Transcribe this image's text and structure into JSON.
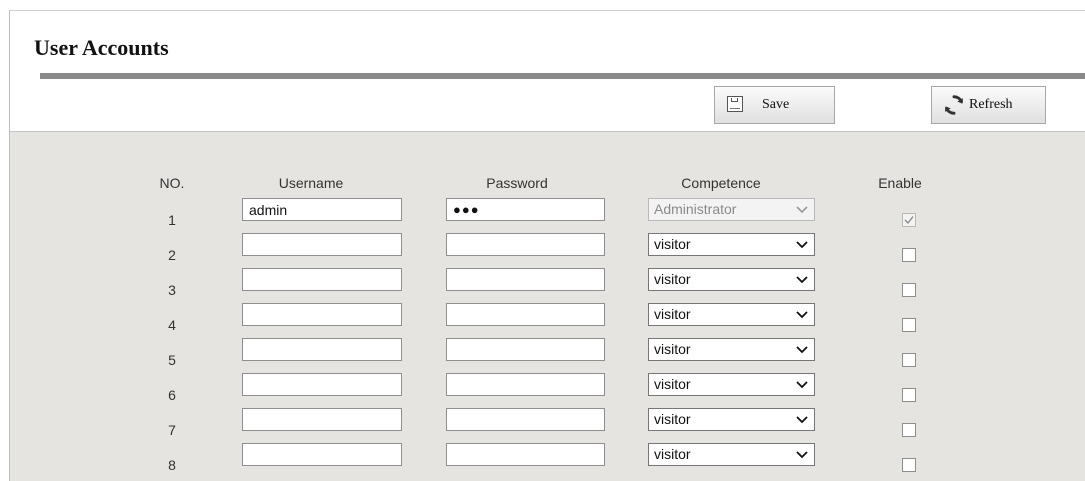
{
  "header": {
    "title": "User Accounts",
    "save_label": "Save",
    "refresh_label": "Refresh"
  },
  "table": {
    "columns": [
      "NO.",
      "Username",
      "Password",
      "Competence",
      "Enable"
    ],
    "rows": [
      {
        "no": "1",
        "username": "admin",
        "password": "●●●",
        "competence": "Administrator",
        "enabled": true,
        "locked": true
      },
      {
        "no": "2",
        "username": "",
        "password": "",
        "competence": "visitor",
        "enabled": false,
        "locked": false
      },
      {
        "no": "3",
        "username": "",
        "password": "",
        "competence": "visitor",
        "enabled": false,
        "locked": false
      },
      {
        "no": "4",
        "username": "",
        "password": "",
        "competence": "visitor",
        "enabled": false,
        "locked": false
      },
      {
        "no": "5",
        "username": "",
        "password": "",
        "competence": "visitor",
        "enabled": false,
        "locked": false
      },
      {
        "no": "6",
        "username": "",
        "password": "",
        "competence": "visitor",
        "enabled": false,
        "locked": false
      },
      {
        "no": "7",
        "username": "",
        "password": "",
        "competence": "visitor",
        "enabled": false,
        "locked": false
      },
      {
        "no": "8",
        "username": "",
        "password": "",
        "competence": "visitor",
        "enabled": false,
        "locked": false
      }
    ]
  },
  "colors": {
    "panel_background": "#e5e4e1",
    "title_rule": "#888888"
  },
  "icons": {
    "save": "floppy-disk-icon",
    "refresh": "refresh-arrows-icon",
    "dropdown": "chevron-down-icon",
    "check": "checkmark-icon"
  }
}
